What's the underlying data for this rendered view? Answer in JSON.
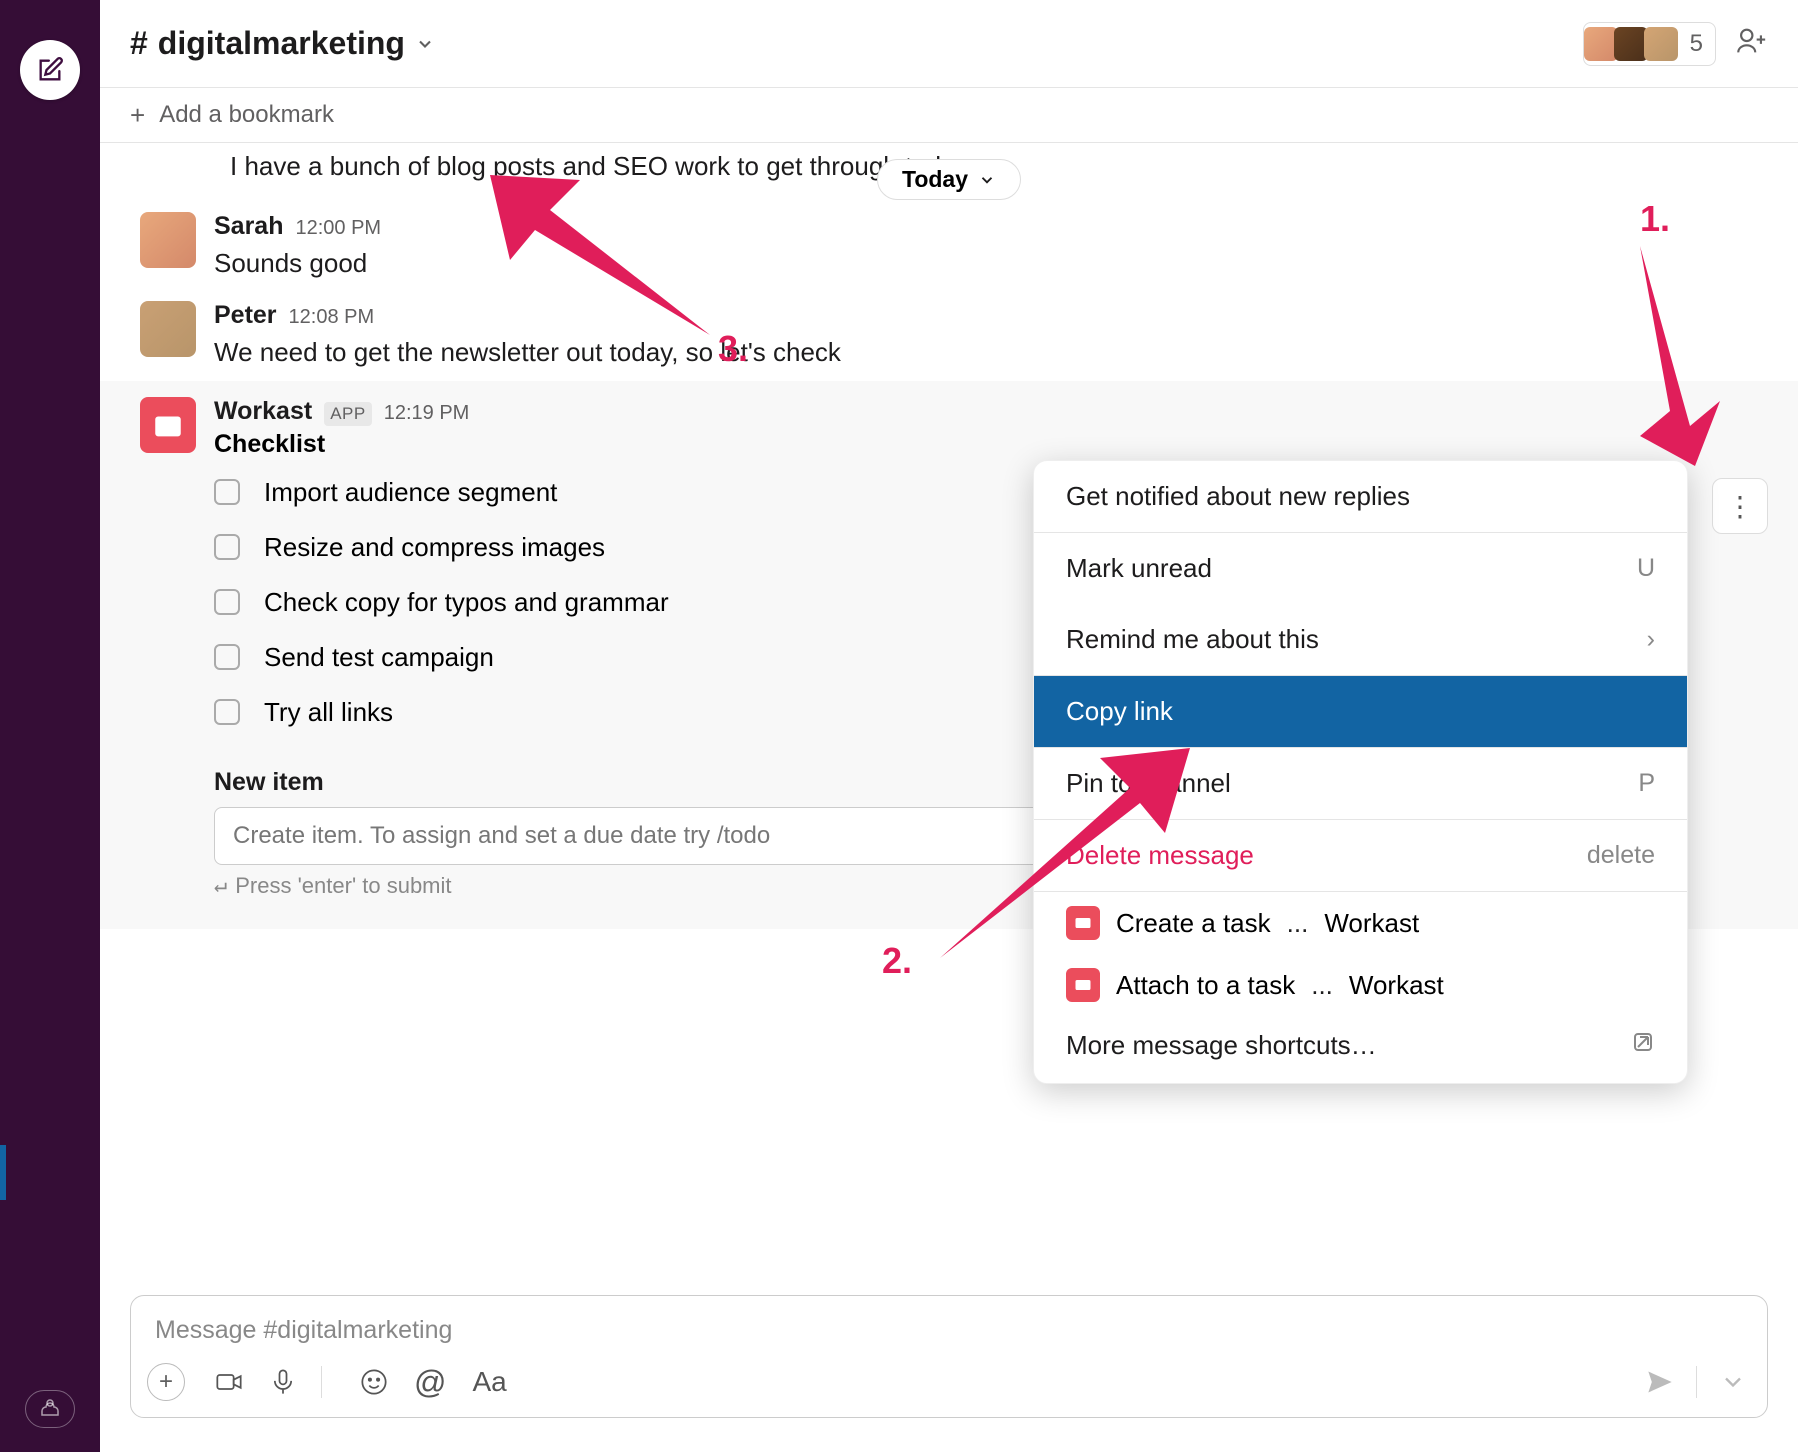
{
  "header": {
    "channel_name": "digitalmarketing",
    "member_count": "5"
  },
  "bookmark": {
    "label": "Add a bookmark"
  },
  "date_pill": "Today",
  "messages": {
    "line0": "I have a bunch of blog posts and SEO work to get through today",
    "sarah": {
      "name": "Sarah",
      "time": "12:00 PM",
      "text": "Sounds good"
    },
    "peter": {
      "name": "Peter",
      "time": "12:08 PM",
      "text": "We need to get the newsletter out today, so let's check"
    },
    "workast": {
      "name": "Workast",
      "badge": "APP",
      "time": "12:19 PM",
      "title": "Checklist",
      "items": [
        "Import audience segment",
        "Resize and compress images",
        "Check copy for typos and grammar",
        "Send test campaign",
        "Try all links"
      ],
      "new_item_label": "New item",
      "new_item_placeholder": "Create item. To assign and set a due date try /todo",
      "enter_hint": "Press 'enter' to submit"
    }
  },
  "context_menu": {
    "notify": "Get notified about new replies",
    "unread": "Mark unread",
    "unread_key": "U",
    "remind": "Remind me about this",
    "copy": "Copy link",
    "pin": "Pin to channel",
    "pin_key": "P",
    "delete": "Delete message",
    "delete_key": "delete",
    "create_task": "Create a task",
    "attach_task": "Attach to a task",
    "shortcut_dots": "...",
    "shortcut_app": "Workast",
    "more_shortcuts": "More message shortcuts…"
  },
  "composer": {
    "placeholder": "Message #digitalmarketing",
    "aa": "Aa"
  },
  "annotations": {
    "a1": "1.",
    "a2": "2.",
    "a3": "3."
  }
}
